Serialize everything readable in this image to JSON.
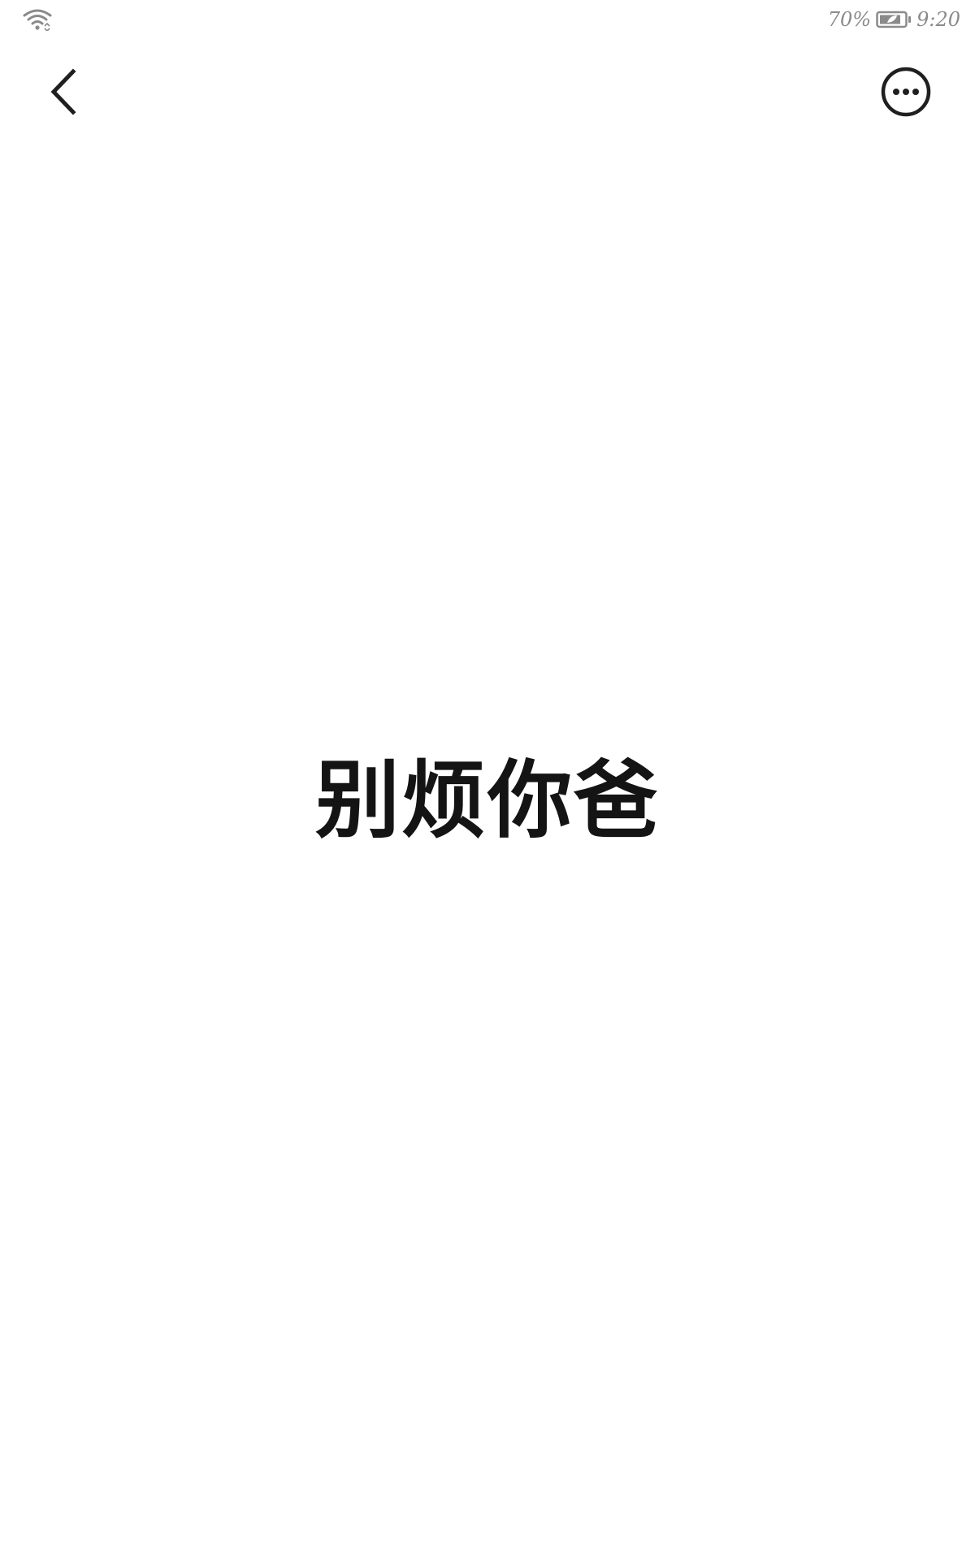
{
  "status_bar": {
    "wifi_icon": "wifi-icon",
    "battery_percent": "70%",
    "battery_icon": "battery-saver-icon",
    "time": "9:20"
  },
  "toolbar": {
    "back_icon": "chevron-left-icon",
    "more_icon": "more-horizontal-circle-icon"
  },
  "content": {
    "image_text": "别烦你爸"
  }
}
